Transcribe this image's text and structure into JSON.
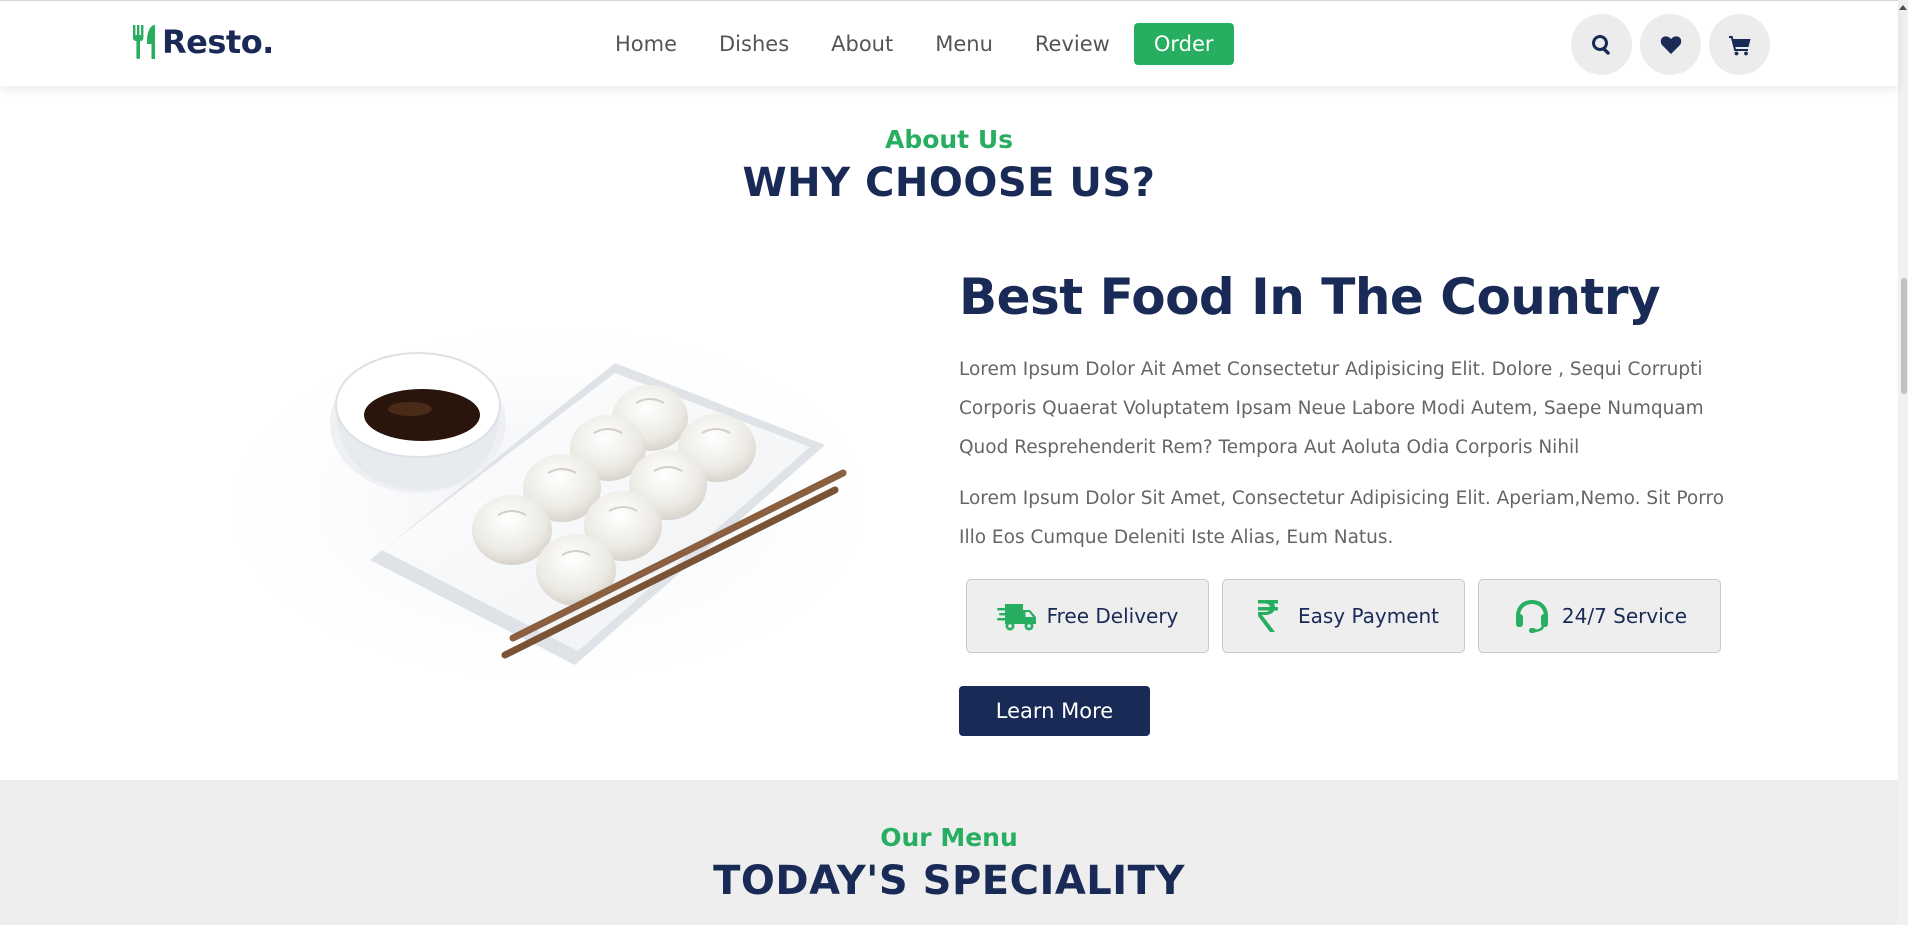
{
  "header": {
    "logo_text": "Resto.",
    "logo_icon": "utensils-icon",
    "nav": [
      {
        "label": "Home"
      },
      {
        "label": "Dishes"
      },
      {
        "label": "About"
      },
      {
        "label": "Menu"
      },
      {
        "label": "Review"
      }
    ],
    "order_label": "Order",
    "icons": [
      "search-icon",
      "heart-icon",
      "cart-icon"
    ]
  },
  "about": {
    "subheading": "About Us",
    "heading": "WHY CHOOSE US?",
    "image": "dumplings-with-soy-sauce-and-chopsticks",
    "title": "Best Food In The Country",
    "paragraph_1": "Lorem Ipsum Dolor Ait Amet Consectetur Adipisicing Elit. Dolore , Sequi Corrupti Corporis Quaerat Voluptatem Ipsam Neue Labore Modi Autem, Saepe Numquam Quod Resprehenderit Rem? Tempora Aut Aoluta Odia Corporis Nihil",
    "paragraph_2": "Lorem Ipsum Dolor Sit Amet, Consectetur Adipisicing Elit. Aperiam,Nemo. Sit Porro Illo Eos Cumque Deleniti Iste Alias, Eum Natus.",
    "features": [
      {
        "label": "Free Delivery",
        "icon": "shipping-fast-icon"
      },
      {
        "label": "Easy Payment",
        "icon": "rupee-icon"
      },
      {
        "label": "24/7 Service",
        "icon": "headset-icon"
      }
    ],
    "button_label": "Learn More"
  },
  "menu": {
    "subheading": "Our Menu",
    "heading": "TODAY'S SPECIALITY"
  },
  "colors": {
    "accent": "#27ae60",
    "navy": "#192a56",
    "text": "#666666",
    "section_bg": "#eeeeee"
  }
}
